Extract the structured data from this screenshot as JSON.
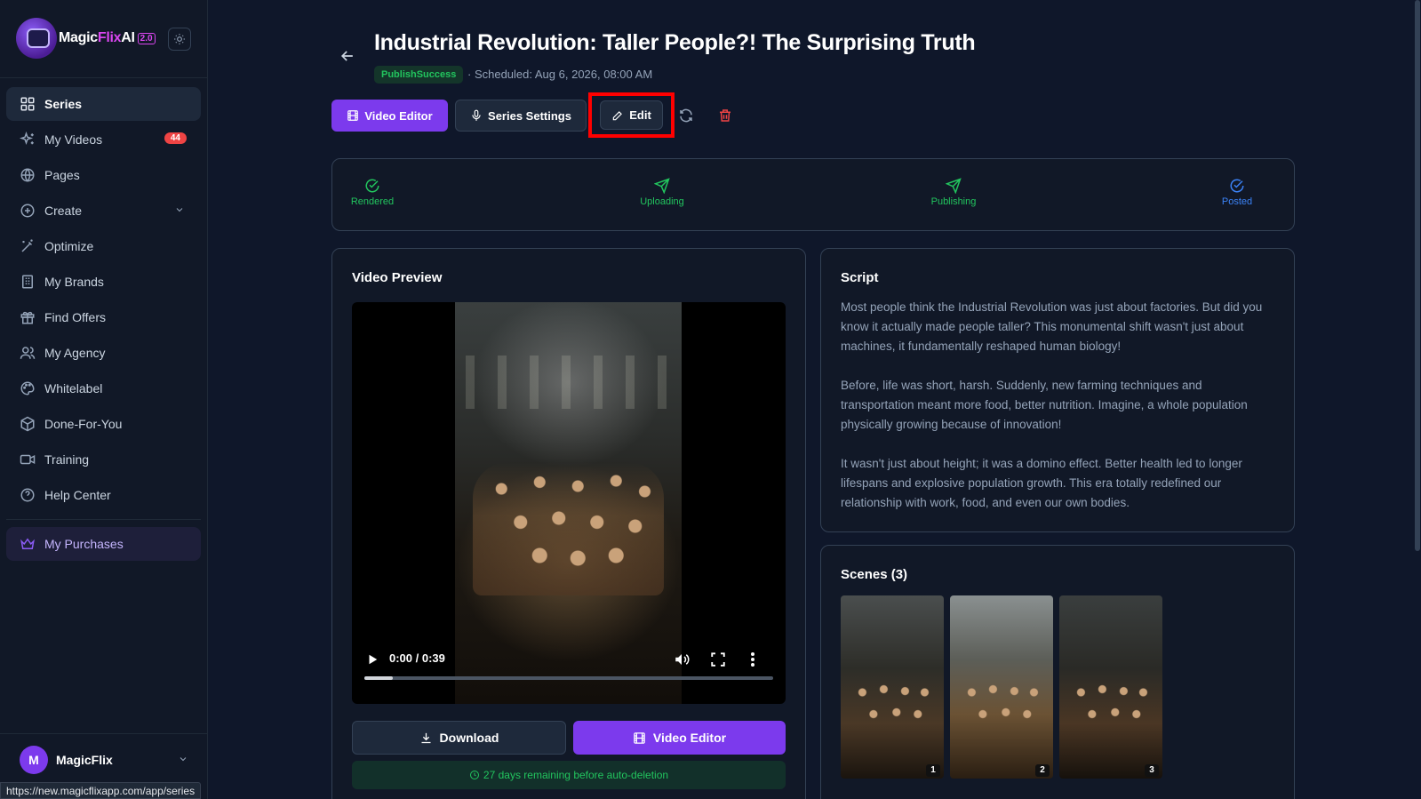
{
  "app": {
    "logo_text_a": "Magic",
    "logo_text_b": "Flix",
    "logo_text_c": "AI",
    "logo_version": "2.0"
  },
  "sidebar": {
    "items": [
      {
        "label": "Series",
        "icon": "grid-icon",
        "active": true
      },
      {
        "label": "My Videos",
        "icon": "sparkles-icon",
        "badge": "44"
      },
      {
        "label": "Pages",
        "icon": "globe-icon"
      },
      {
        "label": "Create",
        "icon": "plus-circle-icon",
        "has_chevron": true
      },
      {
        "label": "Optimize",
        "icon": "wand-icon"
      },
      {
        "label": "My Brands",
        "icon": "building-icon"
      },
      {
        "label": "Find Offers",
        "icon": "gift-icon"
      },
      {
        "label": "My Agency",
        "icon": "users-icon"
      },
      {
        "label": "Whitelabel",
        "icon": "palette-icon"
      },
      {
        "label": "Done-For-You",
        "icon": "package-icon"
      },
      {
        "label": "Training",
        "icon": "video-icon"
      },
      {
        "label": "Help Center",
        "icon": "help-circle-icon"
      }
    ],
    "purchases": {
      "label": "My Purchases",
      "icon": "crown-icon"
    },
    "user": {
      "initial": "M",
      "name": "MagicFlix"
    }
  },
  "status_bar_url": "https://new.magicflixapp.com/app/series",
  "header": {
    "title": "Industrial Revolution: Taller People?! The Surprising Truth",
    "status": "PublishSuccess",
    "scheduled": "· Scheduled: Aug 6, 2026, 08:00 AM"
  },
  "toolbar": {
    "video_editor": "Video Editor",
    "series_settings": "Series Settings",
    "edit": "Edit"
  },
  "progress": {
    "steps": [
      "Rendered",
      "Uploading",
      "Publishing",
      "Posted"
    ]
  },
  "video_preview": {
    "title": "Video Preview",
    "time": "0:00 / 0:39",
    "progress": 0.07,
    "download": "Download",
    "video_editor": "Video Editor",
    "auto_delete": "27 days remaining before auto-deletion"
  },
  "script": {
    "title": "Script",
    "paragraphs": [
      "Most people think the Industrial Revolution was just about factories. But did you know it actually made people taller? This monumental shift wasn't just about machines, it fundamentally reshaped human biology!",
      "Before, life was short, harsh. Suddenly, new farming techniques and transportation meant more food, better nutrition. Imagine, a whole population physically growing because of innovation!",
      "It wasn't just about height; it was a domino effect. Better health led to longer lifespans and explosive population growth. This era totally redefined our relationship with work, food, and even our own bodies."
    ]
  },
  "scenes": {
    "title": "Scenes (3)",
    "items": [
      "1",
      "2",
      "3"
    ]
  },
  "colors": {
    "accent": "#7c3aed",
    "success": "#22c55e",
    "posted": "#3b82f6",
    "danger": "#ef4444"
  }
}
